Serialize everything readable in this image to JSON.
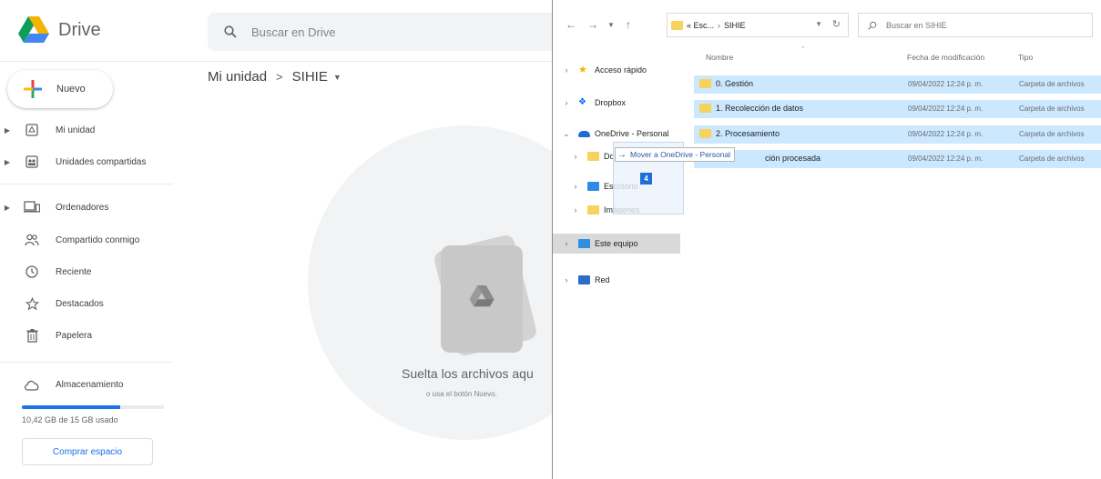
{
  "drive": {
    "app_name": "Drive",
    "search_placeholder": "Buscar en Drive",
    "new_label": "Nuevo",
    "nav": [
      {
        "label": "Mi unidad",
        "icon": "drive-icon"
      },
      {
        "label": "Unidades compartidas",
        "icon": "shared-drive-icon"
      },
      {
        "label": "Ordenadores",
        "icon": "computer-icon"
      },
      {
        "label": "Compartido conmigo",
        "icon": "people-icon"
      },
      {
        "label": "Reciente",
        "icon": "clock-icon"
      },
      {
        "label": "Destacados",
        "icon": "star-icon"
      },
      {
        "label": "Papelera",
        "icon": "trash-icon"
      },
      {
        "label": "Almacenamiento",
        "icon": "cloud-icon"
      }
    ],
    "storage_text": "10,42 GB de 15 GB usado",
    "storage_fraction": 0.69,
    "buy_storage_label": "Comprar espacio",
    "breadcrumb": [
      "Mi unidad",
      "SIHIE"
    ],
    "drop_title": "Suelta los archivos aqu",
    "drop_subtitle": "o usa el botón Nuevo.",
    "colors": {
      "accent": "#1a73e8",
      "green": "#0f9d58",
      "yellow": "#f4b400",
      "red": "#db4437"
    }
  },
  "explorer": {
    "address": [
      "« Esc...",
      "SIHIE"
    ],
    "search_placeholder": "Buscar en SIHIE",
    "tree": [
      {
        "label": "Acceso rápido",
        "icon": "star-icon"
      },
      {
        "label": "Dropbox",
        "icon": "dropbox-icon"
      },
      {
        "label": "OneDrive - Personal",
        "icon": "onedrive-icon"
      },
      {
        "label": "Do...",
        "icon": "folder-icon"
      },
      {
        "label": "Escritorio",
        "icon": "desktop-folder-icon"
      },
      {
        "label": "Imágenes",
        "icon": "folder-icon"
      },
      {
        "label": "Este equipo",
        "icon": "pc-icon"
      },
      {
        "label": "Red",
        "icon": "network-icon"
      }
    ],
    "columns": {
      "name": "Nombre",
      "date": "Fecha de modificación",
      "type": "Tipo"
    },
    "files": [
      {
        "name": "0. Gestión",
        "date": "09/04/2022 12:24 p. m.",
        "type": "Carpeta de archivos"
      },
      {
        "name": "1. Recolección de datos",
        "date": "09/04/2022 12:24 p. m.",
        "type": "Carpeta de archivos"
      },
      {
        "name": "2. Procesamiento",
        "date": "09/04/2022 12:24 p. m.",
        "type": "Carpeta de archivos"
      },
      {
        "name": "ción procesada",
        "date": "09/04/2022 12:24 p. m.",
        "type": "Carpeta de archivos"
      }
    ],
    "drag_tooltip": "Mover a OneDrive - Personal",
    "drag_count": "4"
  }
}
